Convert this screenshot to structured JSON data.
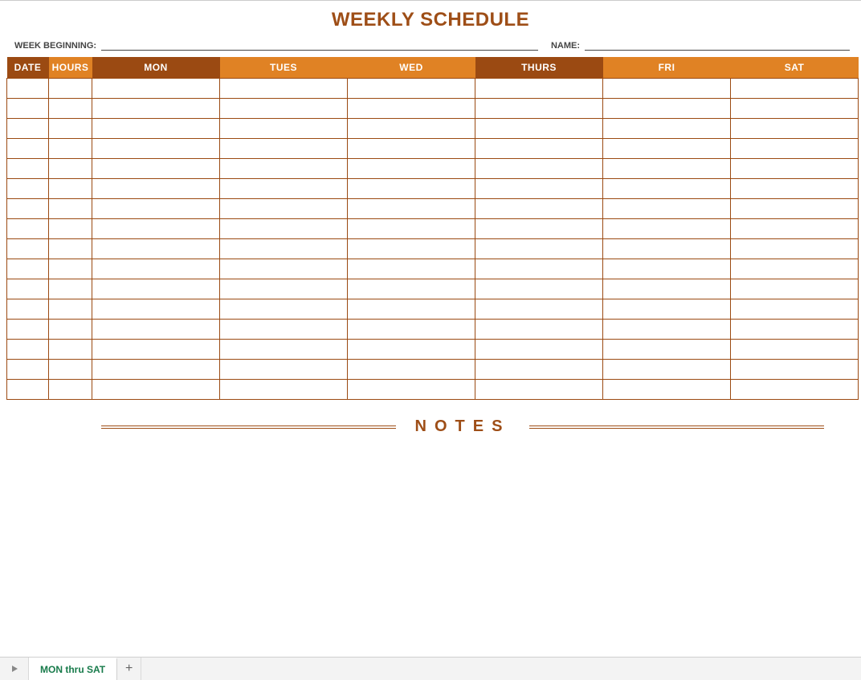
{
  "title": "WEEKLY SCHEDULE",
  "form": {
    "week_beginning_label": "WEEK BEGINNING:",
    "week_beginning_value": "",
    "name_label": "NAME:",
    "name_value": ""
  },
  "table": {
    "headers": [
      "DATE",
      "HOURS",
      "MON",
      "TUES",
      "WED",
      "THURS",
      "FRI",
      "SAT"
    ],
    "row_count": 16,
    "rows": [
      [
        "",
        "",
        "",
        "",
        "",
        "",
        "",
        ""
      ],
      [
        "",
        "",
        "",
        "",
        "",
        "",
        "",
        ""
      ],
      [
        "",
        "",
        "",
        "",
        "",
        "",
        "",
        ""
      ],
      [
        "",
        "",
        "",
        "",
        "",
        "",
        "",
        ""
      ],
      [
        "",
        "",
        "",
        "",
        "",
        "",
        "",
        ""
      ],
      [
        "",
        "",
        "",
        "",
        "",
        "",
        "",
        ""
      ],
      [
        "",
        "",
        "",
        "",
        "",
        "",
        "",
        ""
      ],
      [
        "",
        "",
        "",
        "",
        "",
        "",
        "",
        ""
      ],
      [
        "",
        "",
        "",
        "",
        "",
        "",
        "",
        ""
      ],
      [
        "",
        "",
        "",
        "",
        "",
        "",
        "",
        ""
      ],
      [
        "",
        "",
        "",
        "",
        "",
        "",
        "",
        ""
      ],
      [
        "",
        "",
        "",
        "",
        "",
        "",
        "",
        ""
      ],
      [
        "",
        "",
        "",
        "",
        "",
        "",
        "",
        ""
      ],
      [
        "",
        "",
        "",
        "",
        "",
        "",
        "",
        ""
      ],
      [
        "",
        "",
        "",
        "",
        "",
        "",
        "",
        ""
      ],
      [
        "",
        "",
        "",
        "",
        "",
        "",
        "",
        ""
      ]
    ]
  },
  "notes_heading": "NOTES",
  "tabs": {
    "active_sheet": "MON thru SAT",
    "add_label": "+"
  },
  "colors": {
    "header_dark": "#9b4a12",
    "header_light": "#e08224",
    "accent_text": "#9e4e17",
    "tab_active_text": "#187b4b"
  }
}
